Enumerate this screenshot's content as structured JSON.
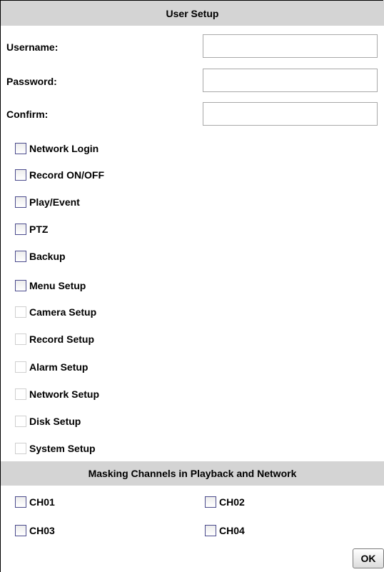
{
  "header": {
    "title": "User Setup"
  },
  "fields": [
    {
      "label": "Username:",
      "value": ""
    },
    {
      "label": "Password:",
      "value": ""
    },
    {
      "label": "Confirm:",
      "value": ""
    }
  ],
  "permissions": [
    {
      "label": "Network Login",
      "checked": false,
      "enabled": true
    },
    {
      "label": "Record ON/OFF",
      "checked": false,
      "enabled": true
    },
    {
      "label": "Play/Event",
      "checked": false,
      "enabled": true
    },
    {
      "label": "PTZ",
      "checked": false,
      "enabled": true
    },
    {
      "label": "Backup",
      "checked": false,
      "enabled": true
    },
    {
      "label": "Menu Setup",
      "checked": false,
      "enabled": true
    },
    {
      "label": "Camera Setup",
      "checked": false,
      "enabled": false
    },
    {
      "label": "Record Setup",
      "checked": false,
      "enabled": false
    },
    {
      "label": "Alarm Setup",
      "checked": false,
      "enabled": false
    },
    {
      "label": "Network Setup",
      "checked": false,
      "enabled": false
    },
    {
      "label": "Disk Setup",
      "checked": false,
      "enabled": false
    },
    {
      "label": "System Setup",
      "checked": false,
      "enabled": false
    }
  ],
  "masking": {
    "title": "Masking Channels in Playback and Network",
    "channels": [
      {
        "label": "CH01",
        "checked": false
      },
      {
        "label": "CH02",
        "checked": false
      },
      {
        "label": "CH03",
        "checked": false
      },
      {
        "label": "CH04",
        "checked": false
      }
    ]
  },
  "ok_label": "OK",
  "colors": {
    "header_bg": "#d4d4d4",
    "checkbox_border": "#4a4a8c",
    "disabled_border": "#cfcfcf"
  }
}
